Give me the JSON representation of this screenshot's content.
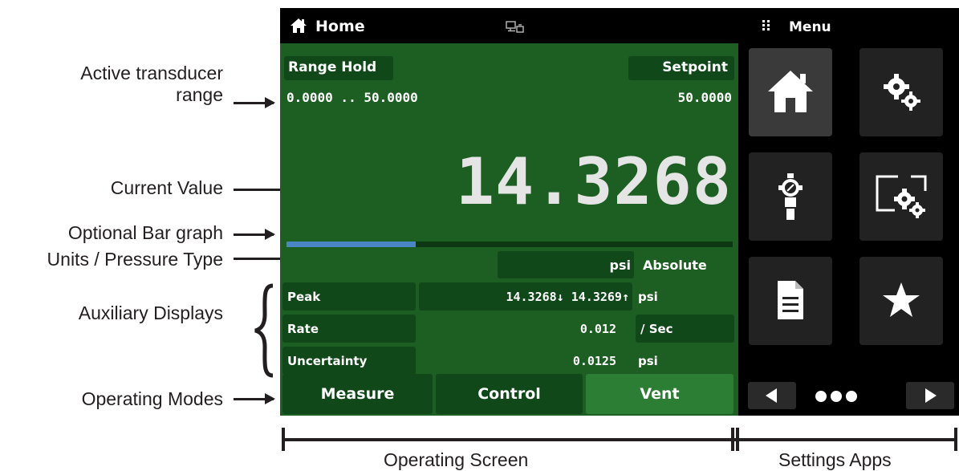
{
  "topbar": {
    "home_label": "Home",
    "menu_label": "Menu",
    "home_icon": "home-icon",
    "network_icon": "network-icon",
    "menu_icon": "grid-dots-icon"
  },
  "range": {
    "hold_label": "Range Hold",
    "setpoint_label": "Setpoint",
    "range_text": "0.0000 .. 50.0000",
    "setpoint_value": "50.0000"
  },
  "reading": {
    "value": "14.3268",
    "bar_fraction": 0.29,
    "units": "psi",
    "pressure_type": "Absolute"
  },
  "aux": {
    "peak_label": "Peak",
    "peak_value": "14.3268↓ 14.3269↑",
    "peak_unit": "psi",
    "rate_label": "Rate",
    "rate_value": "0.012",
    "rate_unit": "/ Sec",
    "uncertainty_label": "Uncertainty",
    "uncertainty_value": "0.0125",
    "uncertainty_unit": "psi"
  },
  "modes": {
    "measure": "Measure",
    "control": "Control",
    "vent": "Vent"
  },
  "callouts": {
    "active_range_line1": "Active transducer",
    "active_range_line2": "range",
    "current_value": "Current Value",
    "bar_graph": "Optional Bar graph",
    "units_type": "Units / Pressure Type",
    "aux_displays": "Auxiliary Displays",
    "operating_modes": "Operating Modes",
    "operating_screen": "Operating Screen",
    "settings_apps": "Settings Apps"
  },
  "colors": {
    "screen_green": "#1d5e22",
    "box_green": "#11481a",
    "bar_blue": "#4a86c5",
    "tile_gray": "#222222"
  }
}
